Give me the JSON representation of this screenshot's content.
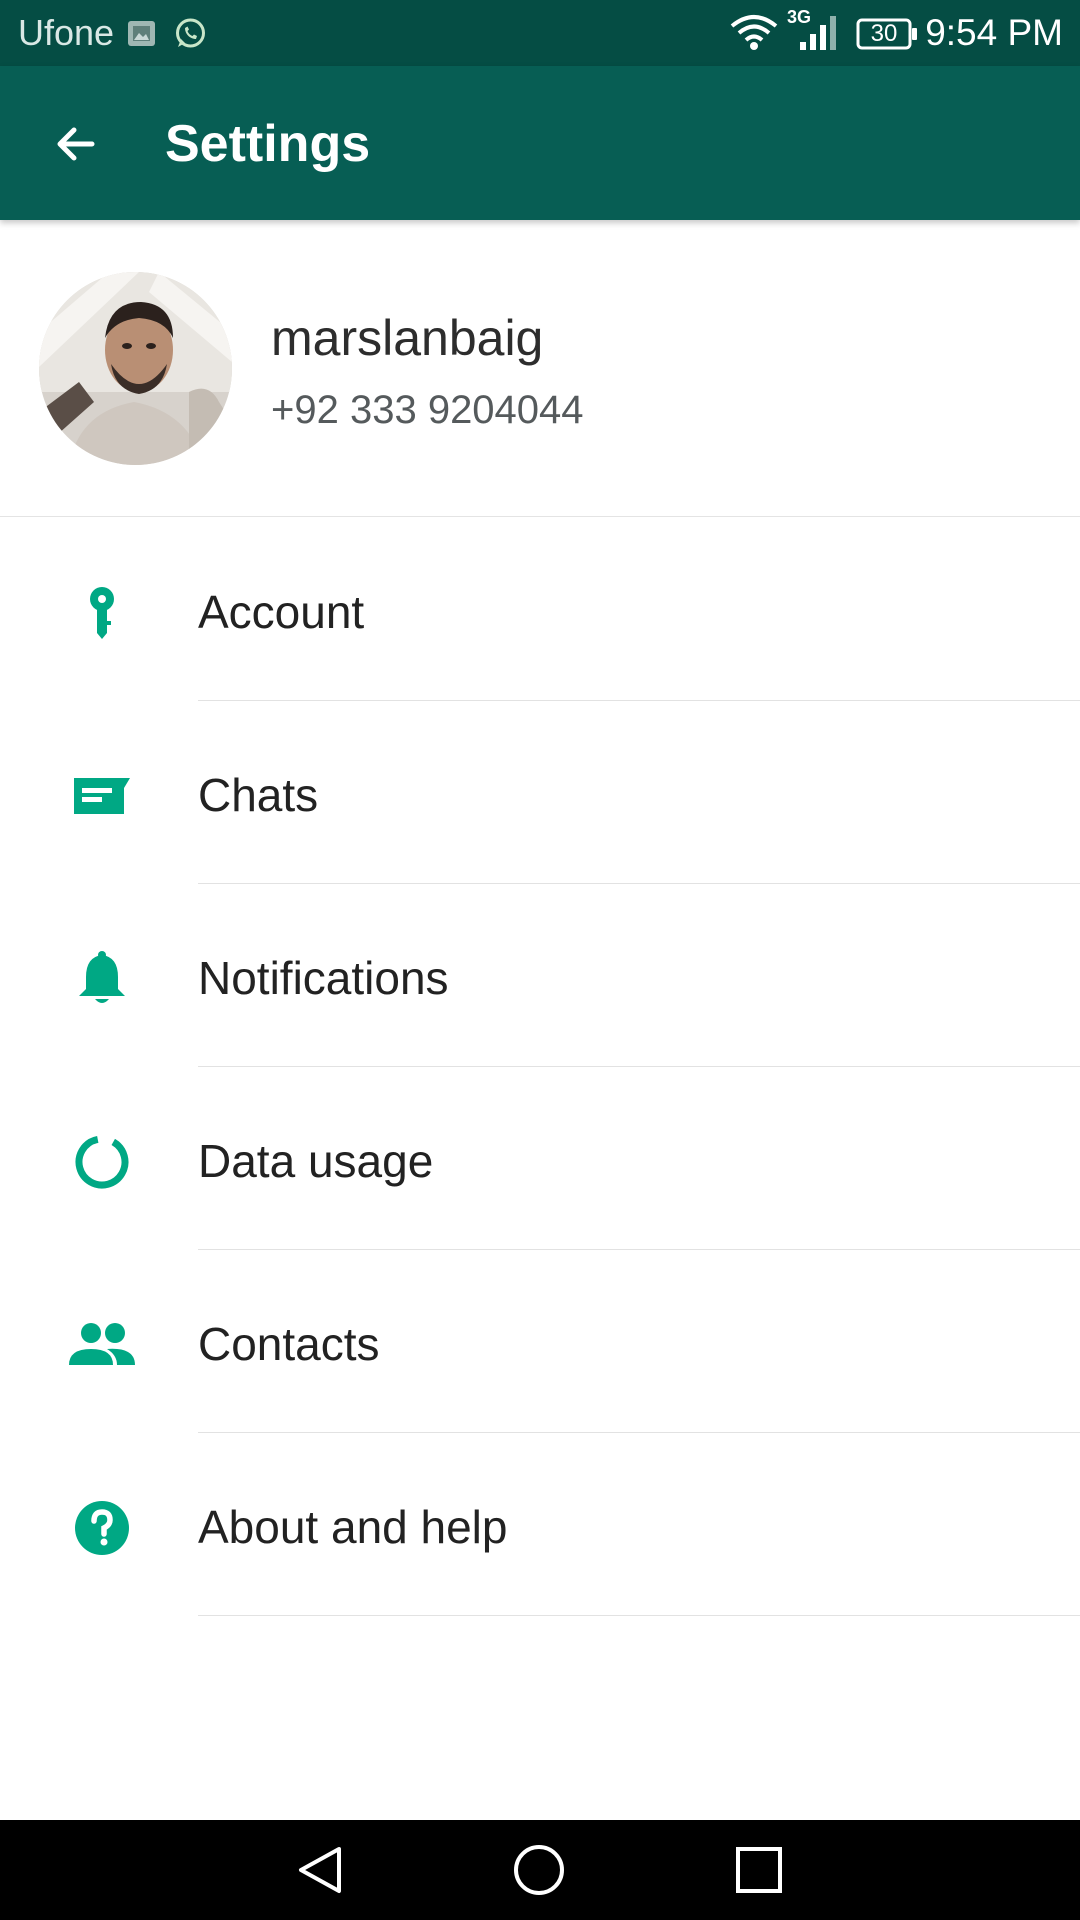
{
  "status_bar": {
    "carrier": "Ufone",
    "network_type": "3G",
    "battery_level": "30",
    "time": "9:54 PM",
    "icons": [
      "gallery-icon",
      "whatsapp-icon",
      "wifi-icon",
      "signal-icon",
      "battery-icon"
    ]
  },
  "app_bar": {
    "title": "Settings",
    "back_icon": "arrow-back-icon"
  },
  "profile": {
    "name": "marslanbaig",
    "phone": "+92 333 9204044"
  },
  "settings": {
    "items": [
      {
        "label": "Account",
        "icon": "key-icon"
      },
      {
        "label": "Chats",
        "icon": "chat-icon"
      },
      {
        "label": "Notifications",
        "icon": "bell-icon"
      },
      {
        "label": "Data usage",
        "icon": "data-usage-icon"
      },
      {
        "label": "Contacts",
        "icon": "contacts-icon"
      },
      {
        "label": "About and help",
        "icon": "help-icon"
      }
    ]
  },
  "nav_bar": {
    "buttons": [
      "back-nav-icon",
      "home-nav-icon",
      "recents-nav-icon"
    ]
  },
  "colors": {
    "status_bar": "#054d44",
    "app_bar": "#075e54",
    "accent": "#00a884",
    "text_primary": "#222222",
    "text_secondary": "#555a5c"
  }
}
